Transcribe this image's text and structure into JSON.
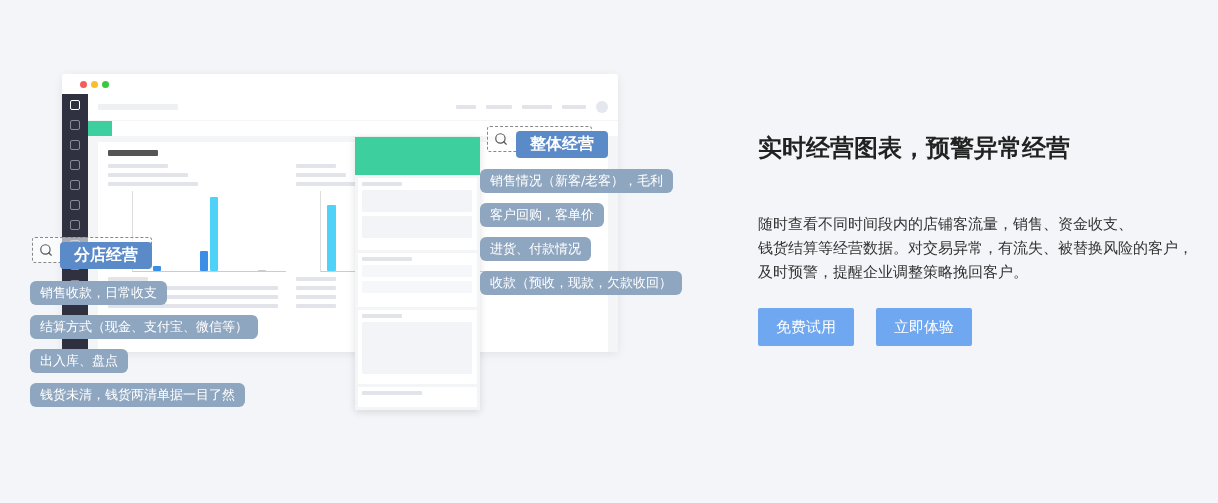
{
  "illustration": {
    "branch_badge": "分店经营",
    "branch_points": [
      "销售收款，日常收支",
      "结算方式（现金、支付宝、微信等）",
      "出入库、盘点",
      "钱货未清，钱货两清单据一目了然"
    ],
    "overall_badge": "整体经营",
    "overall_points": [
      "销售情况（新客/老客），毛利",
      "客户回购，客单价",
      "进货、付款情况",
      "收款（预收，现款，欠款收回）"
    ]
  },
  "headline": "实时经营图表，预警异常经营",
  "description_lines": [
    "随时查看不同时间段内的店铺客流量，销售、资金收支、",
    "钱货结算等经营数据。对交易异常，有流失、被替换风险的客户，",
    "及时预警，提醒企业调整策略挽回客户。"
  ],
  "buttons": [
    {
      "label": "免费试用"
    },
    {
      "label": "立即体验"
    }
  ]
}
